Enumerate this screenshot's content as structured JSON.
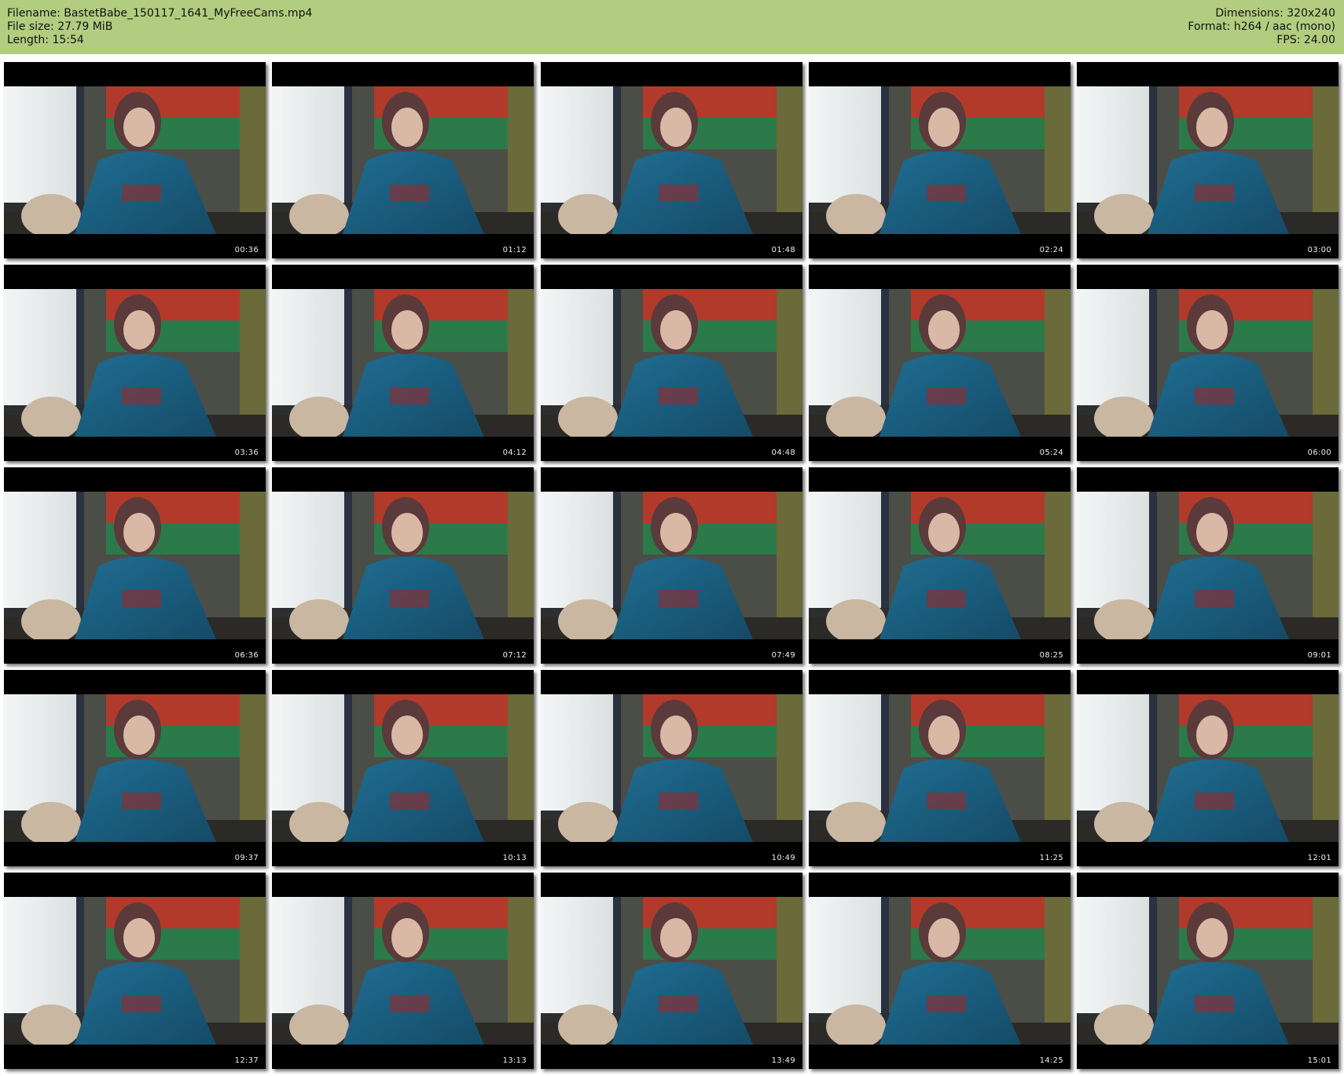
{
  "header": {
    "filename": "Filename: BastetBabe_150117_1641_MyFreeCams.mp4",
    "filesize": "File size: 27.79 MiB",
    "length": "Length: 15:54",
    "dimensions": "Dimensions: 320x240",
    "format": "Format: h264 / aac (mono)",
    "fps": "FPS: 24.00"
  },
  "colors": {
    "header_bg": "#b2cd80",
    "frame_bg": "#000000",
    "timestamp": "#eeeeee"
  },
  "thumbnails": [
    {
      "time": "00:36"
    },
    {
      "time": "01:12"
    },
    {
      "time": "01:48"
    },
    {
      "time": "02:24"
    },
    {
      "time": "03:00"
    },
    {
      "time": "03:36"
    },
    {
      "time": "04:12"
    },
    {
      "time": "04:48"
    },
    {
      "time": "05:24"
    },
    {
      "time": "06:00"
    },
    {
      "time": "06:36"
    },
    {
      "time": "07:12"
    },
    {
      "time": "07:49"
    },
    {
      "time": "08:25"
    },
    {
      "time": "09:01"
    },
    {
      "time": "09:37"
    },
    {
      "time": "10:13"
    },
    {
      "time": "10:49"
    },
    {
      "time": "11:25"
    },
    {
      "time": "12:01"
    },
    {
      "time": "12:37"
    },
    {
      "time": "13:13"
    },
    {
      "time": "13:49"
    },
    {
      "time": "14:25"
    },
    {
      "time": "15:01"
    }
  ]
}
